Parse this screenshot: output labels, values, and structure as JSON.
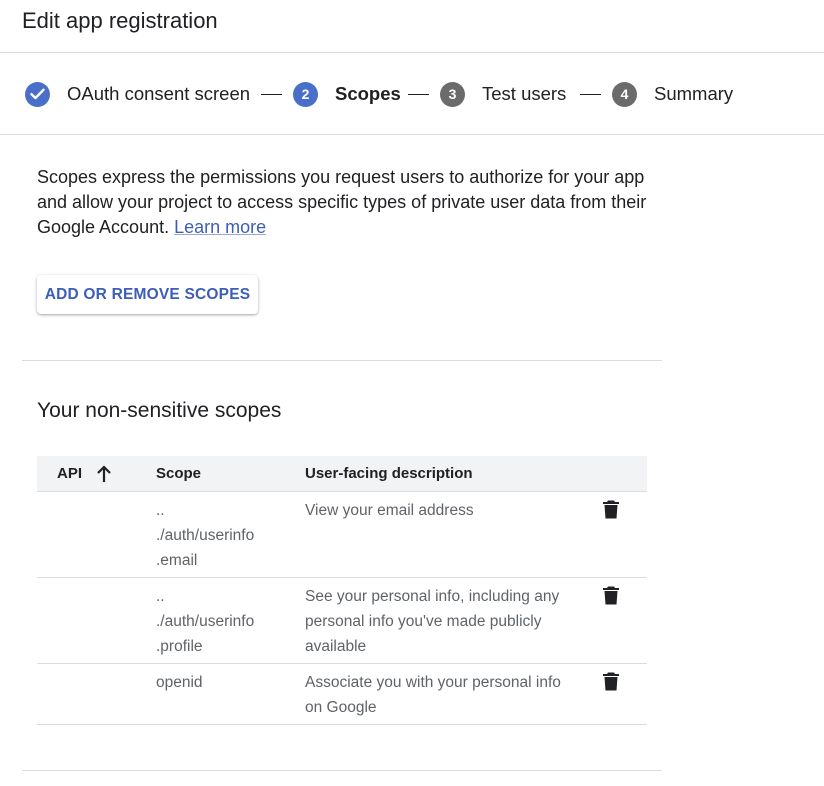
{
  "header": {
    "title": "Edit app registration"
  },
  "stepper": {
    "steps": [
      {
        "number": "",
        "label": "OAuth consent screen",
        "state": "done"
      },
      {
        "number": "2",
        "label": "Scopes",
        "state": "active"
      },
      {
        "number": "3",
        "label": "Test users",
        "state": "pending"
      },
      {
        "number": "4",
        "label": "Summary",
        "state": "pending"
      }
    ]
  },
  "intro": {
    "text": "Scopes express the permissions you request users to authorize for your app and allow your project to access specific types of private user data from their Google Account.",
    "link_label": "Learn more"
  },
  "add_button": {
    "label": "ADD OR REMOVE SCOPES"
  },
  "section": {
    "title": "Your non-sensitive scopes"
  },
  "table": {
    "columns": {
      "api": "API",
      "scope": "Scope",
      "description": "User-facing description"
    },
    "rows": [
      {
        "api": "",
        "scope_lines": [
          "..",
          "./auth/userinfo",
          ".email"
        ],
        "description": "View your email address"
      },
      {
        "api": "",
        "scope_lines": [
          "..",
          "./auth/userinfo",
          ".profile"
        ],
        "description": "See your personal info, including any personal info you've made publicly available"
      },
      {
        "api": "",
        "scope_lines": [
          "openid"
        ],
        "description": "Associate you with your personal info on Google"
      }
    ]
  },
  "colors": {
    "accent": "#4a6fc9",
    "link": "#3c5eb8",
    "pending": "#6b6b6b",
    "divider": "#dadce0"
  },
  "icons": {
    "check": "check-icon",
    "sort": "arrow-upward-icon",
    "delete": "trash-icon"
  }
}
